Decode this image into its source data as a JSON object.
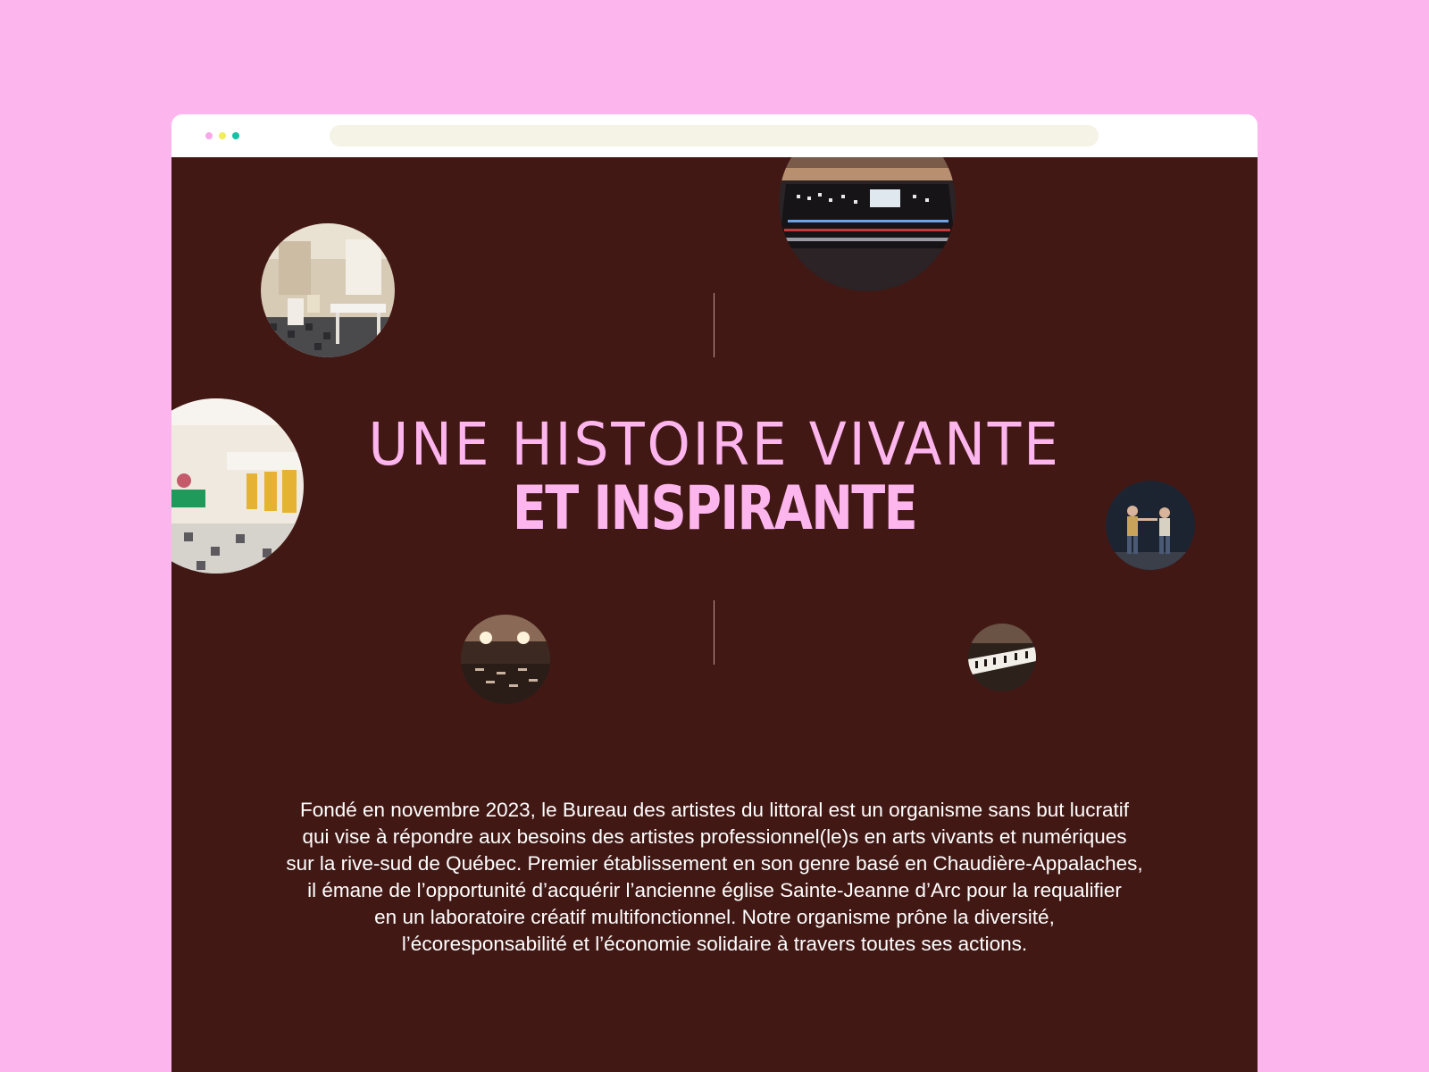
{
  "browser": {
    "dots": [
      {
        "color": "#f7a8e8",
        "label": "pink"
      },
      {
        "color": "#f2ed5a",
        "label": "yellow"
      },
      {
        "color": "#14c2a6",
        "label": "teal"
      }
    ],
    "address_bar_color": "#f5f3e6"
  },
  "colors": {
    "background": "#fdb5ee",
    "page_background": "#421814",
    "title_color": "#fdb5ee",
    "body_text": "#ffffff"
  },
  "hero": {
    "title_line1": "UNE HISTOIRE VIVANTE",
    "title_line2": "ET INSPIRANTE"
  },
  "description": {
    "lines": [
      "Fondé en novembre 2023, le Bureau des artistes du littoral est un organisme sans but lucratif",
      "qui vise à répondre aux besoins des artistes professionnel(le)s en arts vivants et numériques",
      "sur la rive-sud de Québec. Premier établissement en son genre basé en Chaudière-Appalaches,",
      "il émane de l’opportunité d’acquérir l’ancienne église Sainte-Jeanne d’Arc pour la requalifier",
      "en un laboratoire créatif multifonctionnel. Notre organisme prône la diversité,",
      "l’écoresponsabilité et l’économie solidaire à travers toutes ses actions."
    ]
  },
  "photos": [
    {
      "name": "cafe-interior-photo",
      "subject": "café interior with white chairs"
    },
    {
      "name": "mixing-console-photo",
      "subject": "audio mixing console"
    },
    {
      "name": "lounge-interior-photo",
      "subject": "lounge with green sofa and yellow stools"
    },
    {
      "name": "dancers-stage-photo",
      "subject": "performers on stage"
    },
    {
      "name": "concert-hall-photo",
      "subject": "hall with stage lights"
    },
    {
      "name": "piano-photo",
      "subject": "piano keyboard"
    }
  ]
}
